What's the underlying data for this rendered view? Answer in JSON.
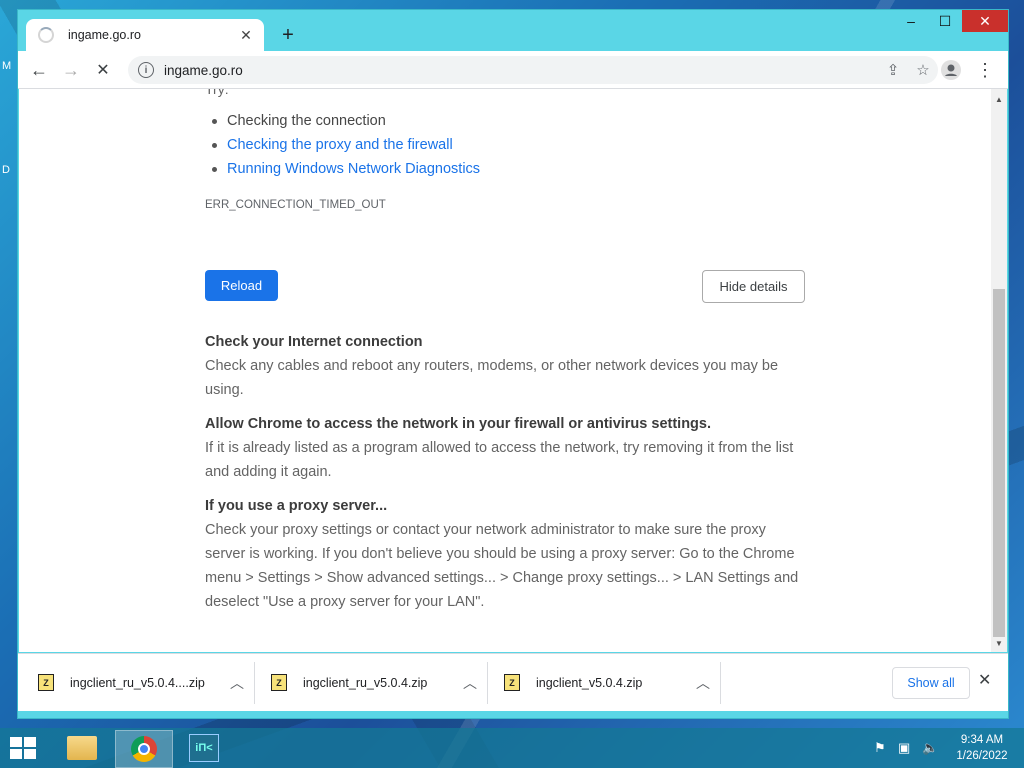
{
  "desktop": {
    "label1": "M",
    "label2": "D"
  },
  "window": {
    "controls": {
      "minimize": "–",
      "maximize": "☐",
      "close": "✕"
    }
  },
  "tab": {
    "title": "ingame.go.ro",
    "close": "✕"
  },
  "new_tab": "+",
  "toolbar": {
    "back": "←",
    "forward": "→",
    "reload": "✕",
    "url": "ingame.go.ro",
    "share": "⇪",
    "star": "☆",
    "menu": "⋮"
  },
  "page": {
    "try_label": "Try:",
    "suggestions": [
      {
        "text": "Checking the connection"
      },
      {
        "text": "Checking the proxy and the firewall"
      },
      {
        "text": "Running Windows Network Diagnostics"
      }
    ],
    "error_code": "ERR_CONNECTION_TIMED_OUT",
    "reload_button": "Reload",
    "details_button": "Hide details",
    "sections": [
      {
        "heading": "Check your Internet connection",
        "body": "Check any cables and reboot any routers, modems, or other network devices you may be using."
      },
      {
        "heading": "Allow Chrome to access the network in your firewall or antivirus settings.",
        "body": "If it is already listed as a program allowed to access the network, try removing it from the list and adding it again."
      },
      {
        "heading": "If you use a proxy server...",
        "body": "Check your proxy settings or contact your network administrator to make sure the proxy server is working. If you don't believe you should be using a proxy server: Go to the Chrome menu > Settings > Show advanced settings... > Change proxy settings... > LAN Settings and deselect \"Use a proxy server for your LAN\"."
      }
    ]
  },
  "downloads": {
    "items": [
      {
        "name": "ingclient_ru_v5.0.4....zip"
      },
      {
        "name": "ingclient_ru_v5.0.4.zip"
      },
      {
        "name": "ingclient_v5.0.4.zip"
      }
    ],
    "show_all": "Show all",
    "close": "✕"
  },
  "taskbar": {
    "time": "9:34 AM",
    "date": "1/26/2022"
  }
}
